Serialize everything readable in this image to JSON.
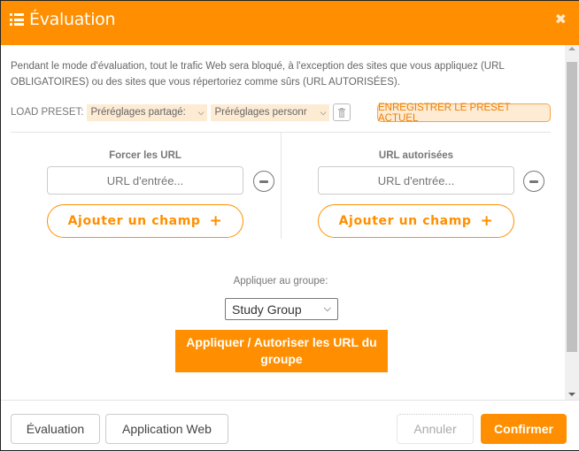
{
  "header": {
    "title": "Évaluation",
    "title_icon": "list-icon",
    "close_icon": "close-icon",
    "close_glyph": "✖"
  },
  "intro_text": "Pendant le mode d'évaluation, tout le trafic Web sera bloqué, à l'exception des sites que vous appliquez (URL OBLIGATOIRES) ou des sites que vous répertoriez comme sûrs (URL AUTORISÉES).",
  "presets": {
    "label": "LOAD PRESET:",
    "shared_selected": "Préréglages partagé:",
    "personal_selected": "Préréglages personr",
    "chevron": "❯",
    "delete_icon": "trash-icon",
    "save_label": "ENREGISTRER LE PRESET ACTUEL"
  },
  "columns": [
    {
      "title": "Forcer les URL",
      "input_placeholder": "URL d'entrée...",
      "input_value": "",
      "add_label": "Ajouter un champ",
      "add_glyph": "+"
    },
    {
      "title": "URL autorisées",
      "input_placeholder": "URL d'entrée...",
      "input_value": "",
      "add_label": "Ajouter un champ",
      "add_glyph": "+"
    }
  ],
  "group": {
    "label": "Appliquer au groupe:",
    "selected": "Study Group",
    "apply_label": "Appliquer / Autoriser les URL du groupe"
  },
  "footer": {
    "tab_evaluation": "Évaluation",
    "tab_webapp": "Application Web",
    "cancel": "Annuler",
    "confirm": "Confirmer"
  },
  "colors": {
    "accent": "#ff8f00",
    "preset_bg": "#fdebd4"
  }
}
